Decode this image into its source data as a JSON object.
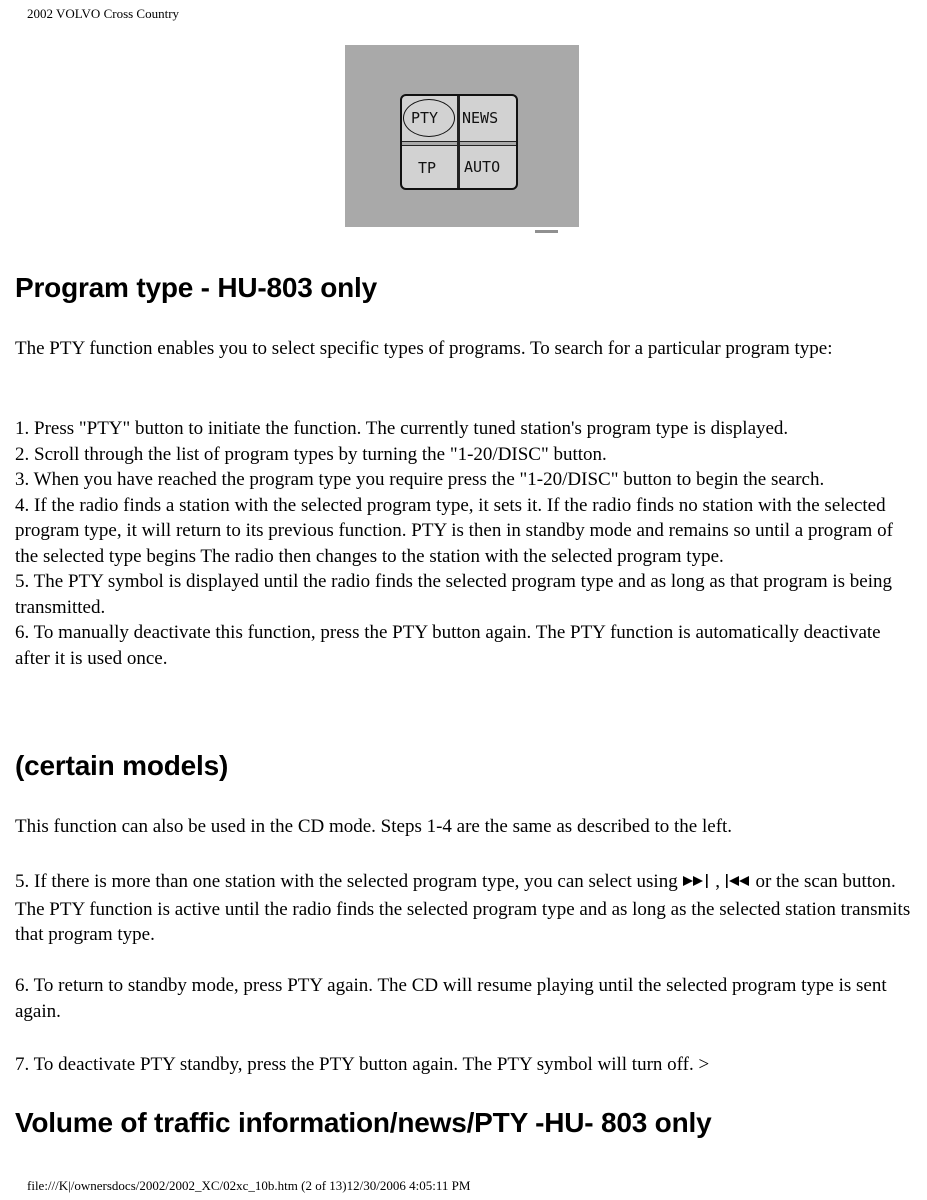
{
  "page_header": "2002 VOLVO Cross Country",
  "figure": {
    "buttons": {
      "pty": "PTY",
      "news": "NEWS",
      "tp": "TP",
      "auto": "AUTO"
    },
    "colors": {
      "background": "#a9a9a9",
      "panel": "#d2d2d2"
    }
  },
  "section1": {
    "heading": "Program type - HU-803 only",
    "intro": "The PTY function enables you to select specific types of programs. To search for a particular program type:",
    "steps": [
      "1. Press \"PTY\" button to initiate the function. The currently tuned station's program type is displayed.",
      "2. Scroll through the list of program types by turning the \"1-20/DISC\" button.",
      "3. When you have reached the program type you require press the \"1-20/DISC\" button to begin the search.",
      "4. If the radio finds a station with the selected program type, it sets it. If the radio finds no station with the selected program type, it will return to its previous function. PTY is then in standby mode and remains so until a program of the selected type begins The radio then changes to the station with the selected program type.",
      "5. The PTY symbol is displayed until the radio finds the selected program type and as long as that program is being transmitted.",
      "6. To manually deactivate this function, press the PTY button again. The PTY function is automatically deactivate after it is used once."
    ]
  },
  "section2": {
    "heading": "(certain models)",
    "cd_mode": "This function can also be used in the CD mode. Steps 1-4 are the same as described to the left.",
    "step5": {
      "before": "5. If there is more than one station with the selected program type, you can select using ",
      "icon_next": "skip-forward-icon",
      "separator": " , ",
      "icon_prev": "skip-back-icon",
      "after": " or the scan button. The PTY function is active until the radio finds the selected program type and as long as the selected station transmits that program type."
    },
    "step6": "6. To return to standby mode, press PTY again. The CD will resume playing until the selected program type is sent again.",
    "step7": "7. To deactivate PTY standby, press the PTY button again. The PTY symbol will turn off. >"
  },
  "section3": {
    "heading": "Volume of traffic information/news/PTY -HU- 803 only"
  },
  "footer": "file:///K|/ownersdocs/2002/2002_XC/02xc_10b.htm (2 of 13)12/30/2006 4:05:11 PM"
}
